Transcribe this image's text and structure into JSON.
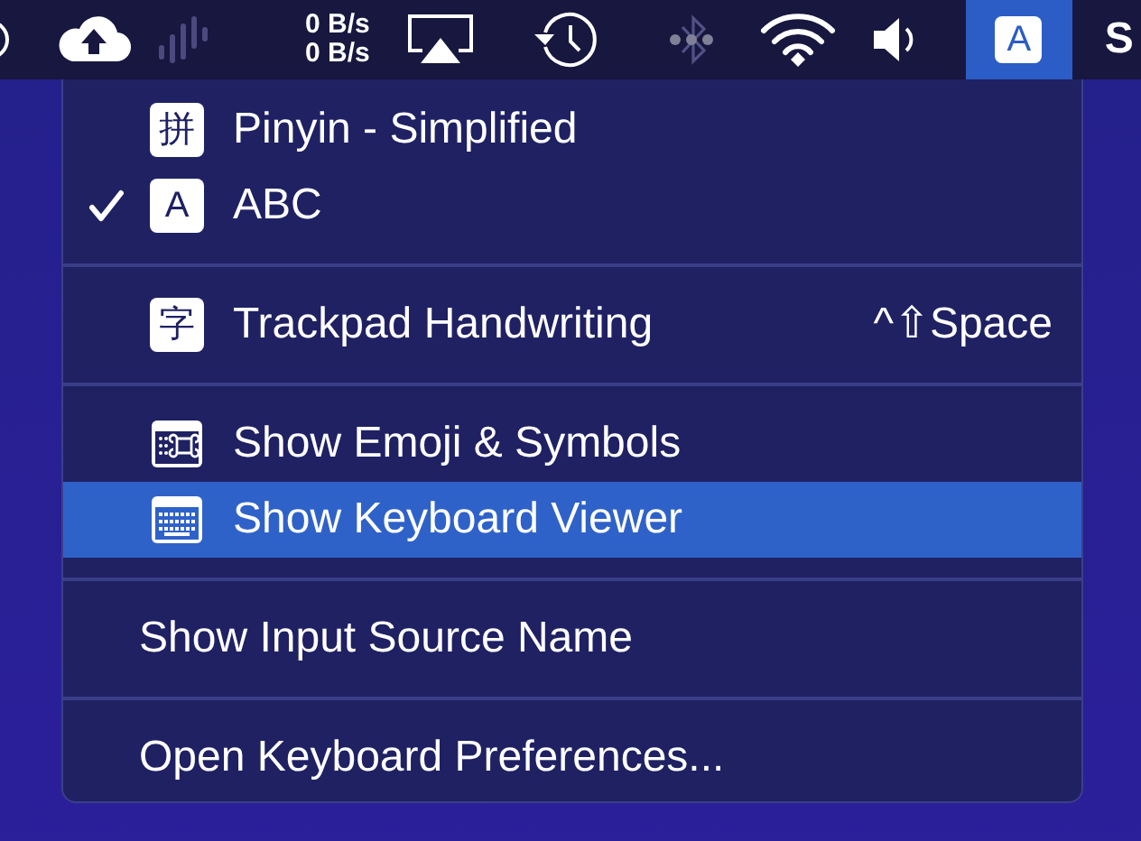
{
  "menu_bar": {
    "items": [
      {
        "kind": "ring",
        "dimmed": false
      },
      {
        "kind": "cloud-upload",
        "dimmed": false
      },
      {
        "kind": "signal",
        "dimmed": true
      },
      {
        "kind": "speed",
        "lines": [
          "0 B/s",
          "0 B/s"
        ]
      },
      {
        "kind": "airplay",
        "dimmed": false
      },
      {
        "kind": "time-machine",
        "dimmed": false
      },
      {
        "kind": "bluetooth",
        "dimmed": true
      },
      {
        "kind": "wifi",
        "dimmed": false
      },
      {
        "kind": "volume",
        "dimmed": false
      },
      {
        "kind": "input",
        "label": "A",
        "selected": true
      },
      {
        "kind": "text",
        "label": "S"
      }
    ]
  },
  "menu": {
    "groups": [
      {
        "items": [
          {
            "kind": "source",
            "badge": "拼",
            "label": "Pinyin - Simplified",
            "checked": false,
            "selected": false
          },
          {
            "kind": "source",
            "badge": "A",
            "label": "ABC",
            "checked": true,
            "selected": false
          }
        ]
      },
      {
        "items": [
          {
            "kind": "source",
            "badge": "字",
            "label": "Trackpad Handwriting",
            "shortcut": "^⇧Space",
            "checked": false,
            "selected": false
          }
        ]
      },
      {
        "items": [
          {
            "kind": "emoji",
            "label": "Show Emoji & Symbols",
            "selected": false
          },
          {
            "kind": "keyboard",
            "label": "Show Keyboard Viewer",
            "selected": true
          }
        ]
      },
      {
        "items": [
          {
            "kind": "plain",
            "label": "Show Input Source Name",
            "selected": false
          }
        ]
      },
      {
        "items": [
          {
            "kind": "plain",
            "label": "Open Keyboard Preferences...",
            "selected": false
          }
        ]
      }
    ]
  }
}
